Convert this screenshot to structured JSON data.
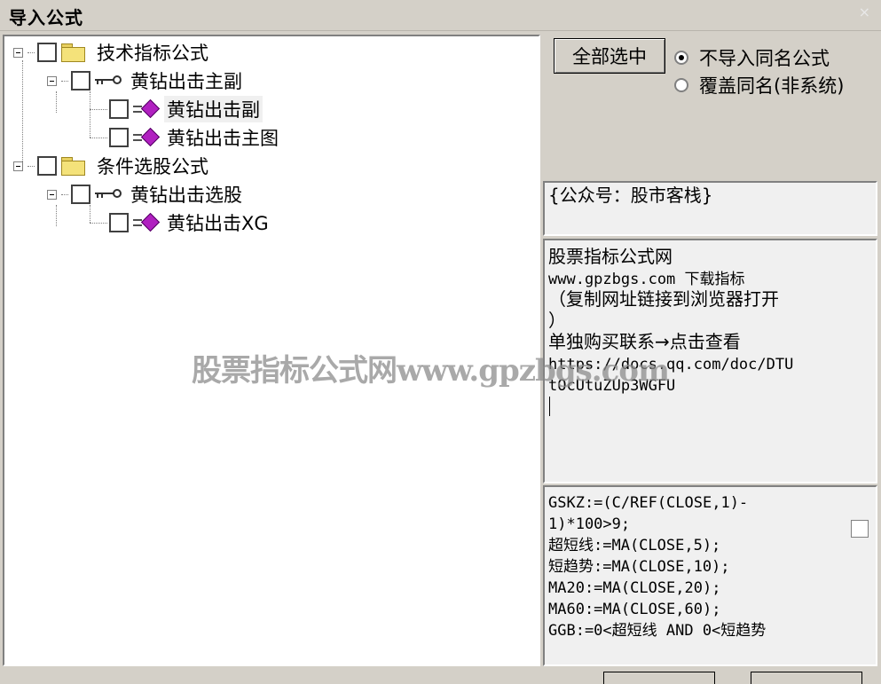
{
  "window": {
    "title": "导入公式",
    "close_glyph": "×"
  },
  "tree": {
    "nodes": [
      {
        "label": "技术指标公式",
        "icon": "folder-icon",
        "level": 0
      },
      {
        "label": "黄钻出击主副",
        "icon": "key-icon",
        "level": 1
      },
      {
        "label": "黄钻出击副",
        "icon": "formula-icon",
        "level": 2,
        "selected": true
      },
      {
        "label": "黄钻出击主图",
        "icon": "formula-icon",
        "level": 2
      },
      {
        "label": "条件选股公式",
        "icon": "folder-icon",
        "level": 0
      },
      {
        "label": "黄钻出击选股",
        "icon": "key-icon",
        "level": 1
      },
      {
        "label": "黄钻出击XG",
        "icon": "formula-icon",
        "level": 2
      }
    ]
  },
  "options": {
    "select_all_label": "全部选中",
    "radio_no_import": "不导入同名公式",
    "radio_overwrite": "覆盖同名(非系统)",
    "selected": "no_import"
  },
  "info_box": {
    "text": "{公众号：股市客栈}"
  },
  "note_box": {
    "line1": "股票指标公式网",
    "line2": "www.gpzbgs.com 下载指标",
    "line3": "（复制网址链接到浏览器打开",
    "line4": "）",
    "line5": "单独购买联系→点击查看",
    "line6": "https://docs.qq.com/doc/DTU",
    "line7": "tOcUtuZUp3WGFU"
  },
  "code_box": {
    "lines": [
      "GSKZ:=(C/REF(CLOSE,1)-",
      "1)*100>9;",
      "超短线:=MA(CLOSE,5);",
      "短趋势:=MA(CLOSE,10);",
      "MA20:=MA(CLOSE,20);",
      "MA60:=MA(CLOSE,60);",
      "GGB:=0<超短线 AND 0<短趋势"
    ]
  },
  "watermark": "股票指标公式网www.gpzbgs.com",
  "colors": {
    "window_bg": "#d4d0c8",
    "panel_bg": "#ffffff",
    "text_bg": "#f0f0f0",
    "gem": "#b020c0",
    "folder": "#f4e27a"
  }
}
